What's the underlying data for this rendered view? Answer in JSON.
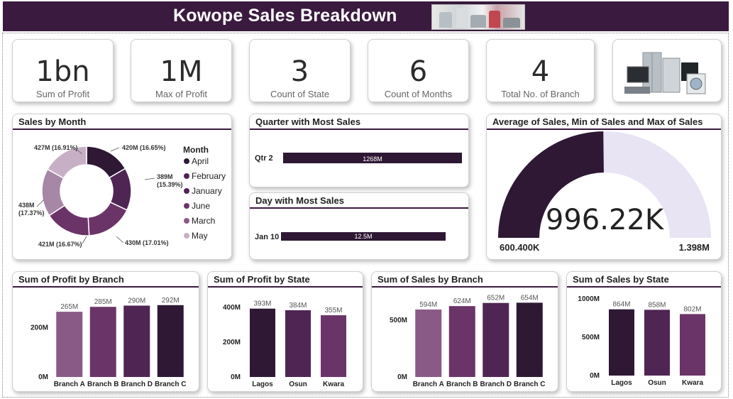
{
  "header": {
    "title": "Kowope Sales Breakdown"
  },
  "kpis": [
    {
      "value": "1bn",
      "label": "Sum of Profit"
    },
    {
      "value": "1M",
      "label": "Max of Profit"
    },
    {
      "value": "3",
      "label": "Count of State"
    },
    {
      "value": "6",
      "label": "Count of Months"
    },
    {
      "value": "4",
      "label": "Total No. of Branch"
    }
  ],
  "colors": {
    "header": "#3a1a3e",
    "dark": "#2e1834",
    "mid": "#4f2653",
    "violet": "#6b3468",
    "mauve": "#8a5a86",
    "light": "#a688a6",
    "pale": "#c7b0c6",
    "gaugeBg": "#e8e4f4"
  },
  "panels": {
    "sales_by_month": "Sales by Month",
    "quarter": "Quarter with Most Sales",
    "day": "Day with Most Sales",
    "gauge": "Average of Sales, Min of Sales and Max of Sales",
    "profit_branch": "Sum of Profit by Branch",
    "profit_state": "Sum of Profit by State",
    "sales_branch": "Sum of Sales by Branch",
    "sales_state": "Sum of Sales by State"
  },
  "chart_data": [
    {
      "id": "sales_by_month",
      "type": "pie",
      "title": "Sales by Month",
      "legend_title": "Month",
      "legend_position": "right",
      "labels": [
        "April",
        "February",
        "January",
        "June",
        "March",
        "May"
      ],
      "values": [
        420,
        389,
        430,
        421,
        438,
        427
      ],
      "data_labels": [
        "420M (16.65%)",
        "389M (15.39%)",
        "430M (17.01%)",
        "421M (16.67%)",
        "438M (17.37%)",
        "427M (16.91%)"
      ]
    },
    {
      "id": "quarter",
      "type": "bar",
      "title": "Quarter with Most Sales",
      "categories": [
        "Qtr 2"
      ],
      "values": [
        1268
      ],
      "data_labels": [
        "1268M"
      ]
    },
    {
      "id": "day",
      "type": "bar",
      "title": "Day with Most Sales",
      "categories": [
        "Jan 10"
      ],
      "values": [
        12.5
      ],
      "data_labels": [
        "12.5M"
      ]
    },
    {
      "id": "gauge",
      "type": "gauge",
      "title": "Average of Sales, Min of Sales and Max of Sales",
      "value": 996.22,
      "value_label": "996.22K",
      "min": 600.4,
      "min_label": "600.400K",
      "max": 1398,
      "max_label": "1.398M"
    },
    {
      "id": "profit_branch",
      "type": "bar",
      "title": "Sum of Profit by Branch",
      "categories": [
        "Branch A",
        "Branch B",
        "Branch D",
        "Branch C"
      ],
      "values": [
        265,
        285,
        290,
        292
      ],
      "data_labels": [
        "265M",
        "285M",
        "290M",
        "292M"
      ],
      "ylim": [
        0,
        300
      ],
      "yticks": [
        0,
        200
      ],
      "ytick_labels": [
        "0M",
        "200M"
      ]
    },
    {
      "id": "profit_state",
      "type": "bar",
      "title": "Sum of Profit by State",
      "categories": [
        "Lagos",
        "Osun",
        "Kwara"
      ],
      "values": [
        393,
        384,
        355
      ],
      "data_labels": [
        "393M",
        "384M",
        "355M"
      ],
      "ylim": [
        0,
        400
      ],
      "yticks": [
        0,
        200,
        400
      ],
      "ytick_labels": [
        "0M",
        "200M",
        "400M"
      ]
    },
    {
      "id": "sales_branch",
      "type": "bar",
      "title": "Sum of Sales by Branch",
      "categories": [
        "Branch A",
        "Branch B",
        "Branch D",
        "Branch C"
      ],
      "values": [
        594,
        624,
        652,
        654
      ],
      "data_labels": [
        "594M",
        "624M",
        "652M",
        "654M"
      ],
      "ylim": [
        0,
        750
      ],
      "yticks": [
        0,
        500
      ],
      "ytick_labels": [
        "0M",
        "500M"
      ]
    },
    {
      "id": "sales_state",
      "type": "bar",
      "title": "Sum of Sales by State",
      "categories": [
        "Lagos",
        "Osun",
        "Kwara"
      ],
      "values": [
        864,
        858,
        802
      ],
      "data_labels": [
        "864M",
        "858M",
        "802M"
      ],
      "ylim": [
        0,
        1000
      ],
      "yticks": [
        0,
        500,
        1000
      ],
      "ytick_labels": [
        "0M",
        "500M",
        "1000M"
      ]
    }
  ]
}
